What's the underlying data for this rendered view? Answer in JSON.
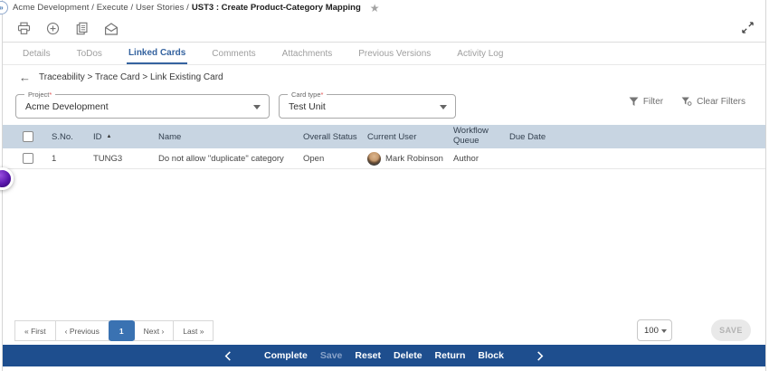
{
  "colors": {
    "accent_blue": "#35639f",
    "action_bar_bg": "#1e4e8e",
    "table_header_bg": "#c8d5e2",
    "active_page_bg": "#3a72b2",
    "required_red": "#e05252"
  },
  "breadcrumb": {
    "path": "Acme Development / Execute / User Stories /",
    "current": "UST3 : Create Product-Category Mapping",
    "star_icon": "star-icon",
    "expand_nav_icon": "double-chevron-right-icon",
    "expand_nav_glyph": "»"
  },
  "toolbar": {
    "icons": [
      "printer-icon",
      "add-circle-icon",
      "copy-icon",
      "email-icon"
    ],
    "expand_icon": "expand-diagonal-icon"
  },
  "tabs": [
    {
      "label": "Details",
      "active": false
    },
    {
      "label": "ToDos",
      "active": false
    },
    {
      "label": "Linked Cards",
      "active": true
    },
    {
      "label": "Comments",
      "active": false
    },
    {
      "label": "Attachments",
      "active": false
    },
    {
      "label": "Previous Versions",
      "active": false
    },
    {
      "label": "Activity Log",
      "active": false
    }
  ],
  "subnav": {
    "back_icon": "back-arrow-icon",
    "back_glyph": "←",
    "trail": "Traceability > Trace Card > Link Existing Card"
  },
  "filters": {
    "project": {
      "label": "Project",
      "required_mark": "*",
      "value": "Acme Development"
    },
    "card_type": {
      "label": "Card type",
      "required_mark": "*",
      "value": "Test Unit"
    },
    "filter_label": "Filter",
    "clear_filters_label": "Clear Filters",
    "filter_icon": "funnel-icon",
    "clear_filters_icon": "funnel-clear-icon"
  },
  "table": {
    "columns": {
      "sno": "S.No.",
      "id": "ID",
      "name": "Name",
      "overall_status": "Overall Status",
      "current_user": "Current User",
      "workflow_queue": "Workflow Queue",
      "due_date": "Due Date"
    },
    "sort": {
      "column": "ID",
      "direction": "ascending",
      "icon": "sort-ascending-icon",
      "glyph": "▲"
    },
    "rows": [
      {
        "sno": "1",
        "id": "TUNG3",
        "name": "Do not allow \"duplicate\" category",
        "overall_status": "Open",
        "current_user": "Mark Robinson",
        "workflow_queue": "Author",
        "due_date": ""
      }
    ]
  },
  "pagination": {
    "first": "« First",
    "previous": "‹ Previous",
    "current_page": "1",
    "next": "Next ›",
    "last": "Last »",
    "page_size": "100"
  },
  "save_button": "SAVE",
  "action_bar": {
    "left_chevron_icon": "chevron-left-icon",
    "right_chevron_icon": "chevron-right-icon",
    "items": [
      {
        "label": "Complete",
        "enabled": true
      },
      {
        "label": "Save",
        "enabled": false
      },
      {
        "label": "Reset",
        "enabled": true
      },
      {
        "label": "Delete",
        "enabled": true
      },
      {
        "label": "Return",
        "enabled": true
      },
      {
        "label": "Block",
        "enabled": true
      }
    ]
  }
}
